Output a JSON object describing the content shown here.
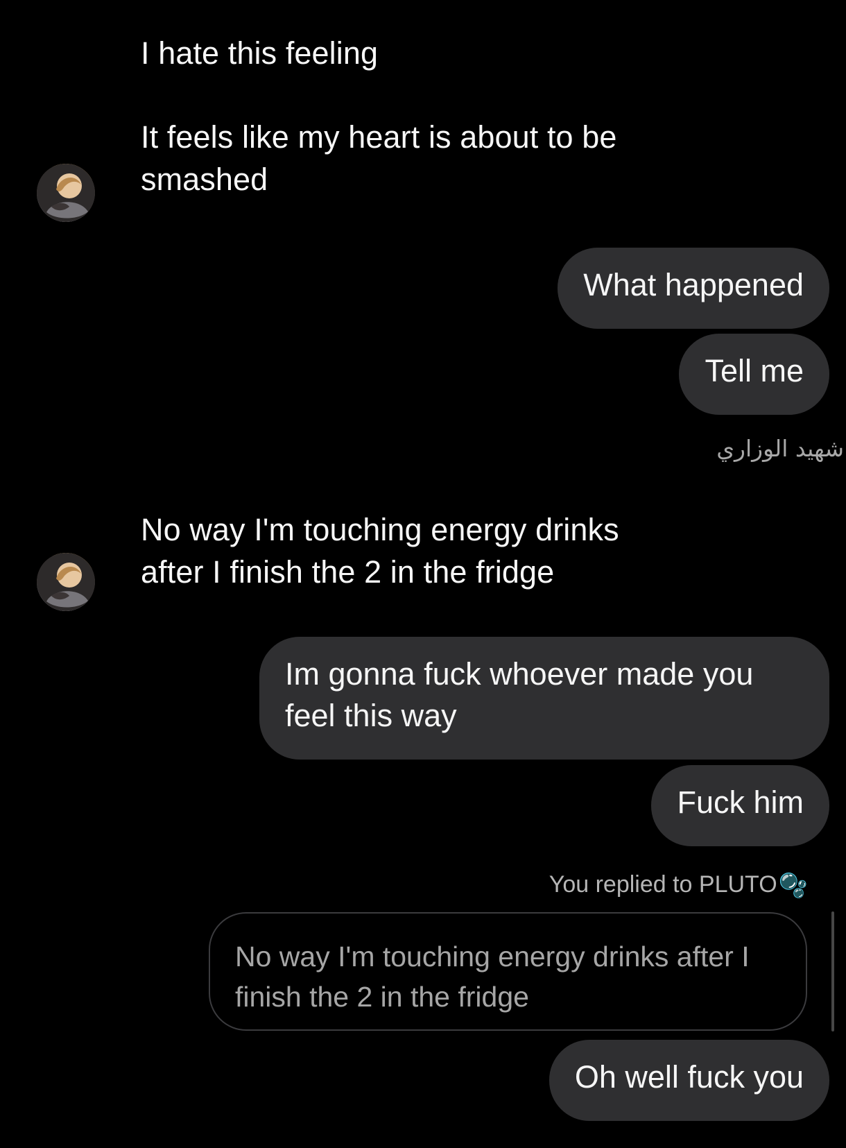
{
  "messages": {
    "first_line": "I hate this feeling",
    "second_line": "It feels like my heart is about to be smashed",
    "what_happened": "What happened",
    "tell_me": "Tell me",
    "sender_name": "شهيد الوزاري",
    "energy_drinks": "No way I'm touching energy drinks after I finish the 2 in the fridge",
    "gonna_fuck": "Im gonna fuck whoever made you feel this way",
    "fuck_him": "Fuck him",
    "reply_label": "You replied to PLUTO",
    "reply_preview": "No way I'm touching energy drinks after I finish the 2 in the fridge",
    "oh_well": "Oh well fuck you"
  },
  "icons": {
    "avatar_icon": "profile-avatar-icon",
    "bubble_icon": "🫧"
  },
  "colors": {
    "background": "#000000",
    "bubble": "#2f2f31",
    "label": "#a8a8a8"
  }
}
